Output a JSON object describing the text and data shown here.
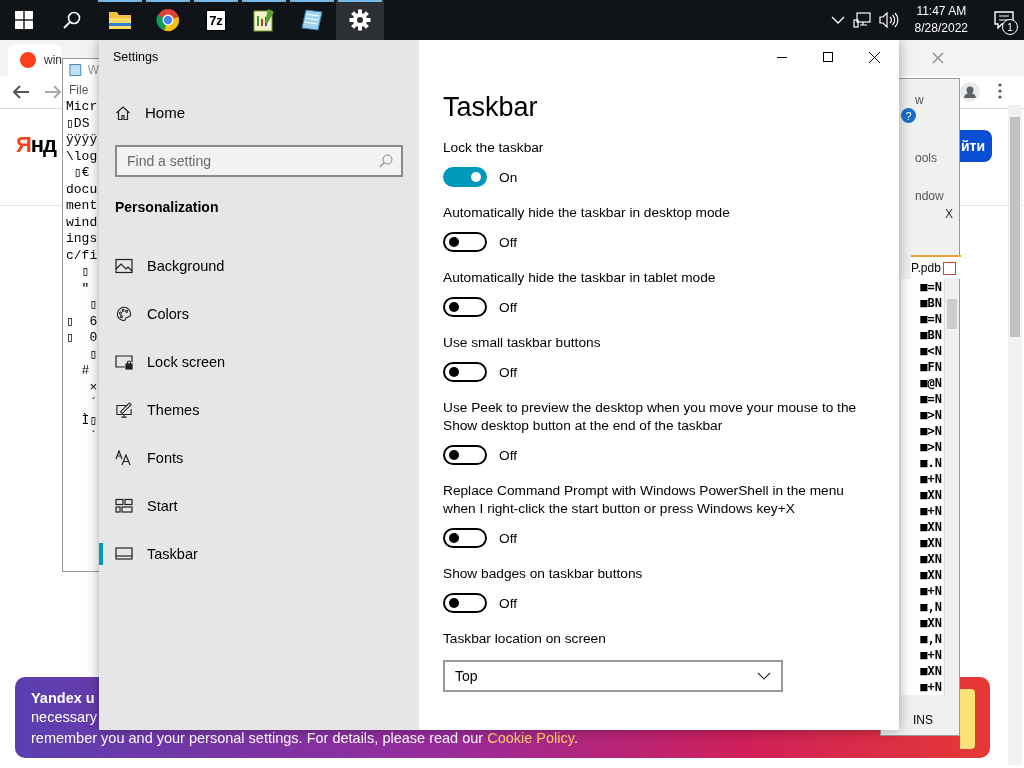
{
  "taskbar": {
    "apps": [
      {
        "kind": "folder",
        "selected": false
      },
      {
        "kind": "browser",
        "selected": false
      },
      {
        "kind": "archiver",
        "label": "7z",
        "selected": false
      },
      {
        "kind": "editor",
        "selected": false
      },
      {
        "kind": "notebook",
        "selected": false
      },
      {
        "kind": "gear",
        "selected": true
      }
    ],
    "time": "11:47 AM",
    "date": "8/28/2022",
    "notifications": "1"
  },
  "browser": {
    "tab_title": "win",
    "logo_text": "Янд",
    "button_text": "йти"
  },
  "banner": {
    "title": "Yandex u",
    "line_2": "necessary",
    "line_3": "remember you and your personal settings. For details, please read our **Cookie Policy**."
  },
  "notepad": {
    "title": "W",
    "menu": "File",
    "lines": [
      "Micr",
      "▯DS",
      "ÿÿÿÿ",
      "\\log",
      " ▯€",
      "docu",
      "ment",
      "wind",
      "ings",
      "c/fi",
      "  ▯",
      "  \"",
      "   ▯",
      "▯  6",
      "▯  0",
      "   ▯",
      "  #",
      "   ×",
      "   ´",
      "  Ì▯",
      "   `"
    ]
  },
  "hex_editor": {
    "menu": [
      "w",
      "ools",
      "ndow"
    ],
    "help": "?",
    "close": "X",
    "file_tab": "P.pdb",
    "lines": [
      "■=N",
      "■BN",
      "■=N",
      "■BN",
      "■<N",
      "■FN",
      "■@N",
      "■=N",
      "■>N",
      "■>N",
      "■>N",
      "■.N",
      "■+N",
      "■XN",
      "■+N",
      "■XN",
      "■XN",
      "■XN",
      "■XN",
      "■+N",
      "■,N",
      "■XN",
      "■,N",
      "■+N",
      "■XN",
      "■+N"
    ],
    "status": "INS"
  },
  "settings": {
    "window_title": "Settings",
    "home": "Home",
    "search": {
      "placeholder": "Find a setting"
    },
    "section": "Personalization",
    "nav": [
      {
        "kind": "background",
        "label": "Background",
        "selected": false
      },
      {
        "kind": "colors",
        "label": "Colors",
        "selected": false
      },
      {
        "kind": "lock",
        "label": "Lock screen",
        "selected": false
      },
      {
        "kind": "themes",
        "label": "Themes",
        "selected": false
      },
      {
        "kind": "fonts",
        "label": "Fonts",
        "selected": false
      },
      {
        "kind": "start",
        "label": "Start",
        "selected": false
      },
      {
        "kind": "taskbar",
        "label": "Taskbar",
        "selected": true
      }
    ],
    "page_title": "Taskbar",
    "toggles": [
      {
        "label": "Lock the taskbar",
        "on": true,
        "state": "On"
      },
      {
        "label": "Automatically hide the taskbar in desktop mode",
        "on": false,
        "state": "Off"
      },
      {
        "label": "Automatically hide the taskbar in tablet mode",
        "on": false,
        "state": "Off"
      },
      {
        "label": "Use small taskbar buttons",
        "on": false,
        "state": "Off"
      },
      {
        "label": "Use Peek to preview the desktop when you move your mouse to the Show desktop button at the end of the taskbar",
        "on": false,
        "state": "Off"
      },
      {
        "label": "Replace Command Prompt with Windows PowerShell in the menu when I right-click the start button or press Windows key+X",
        "on": false,
        "state": "Off"
      },
      {
        "label": "Show badges on taskbar buttons",
        "on": false,
        "state": "Off"
      }
    ],
    "location": {
      "label": "Taskbar location on screen",
      "value": "Top"
    }
  }
}
